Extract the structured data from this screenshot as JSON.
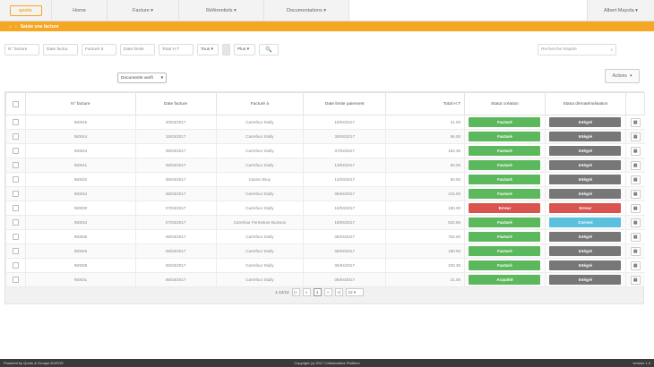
{
  "nav": {
    "logo": "qonto",
    "items": [
      "Home",
      "Facture ▾",
      "Référentiels ▾",
      "Documentations ▾"
    ],
    "user": "Albert Mayola ▾"
  },
  "breadcrumb": {
    "home": "⌂",
    "sep": "›",
    "current": "Saisie une facture"
  },
  "filters": {
    "invoice_no": "N° facture",
    "invoice_date": "Date factur.",
    "billed_to": "Facturé à",
    "due_date": "Date limite",
    "total": "Total H.T",
    "status_select": "Tous ▾",
    "plus_select": "Plus ▾",
    "search_icon": "🔍",
    "quick_search": "Recherche Rapide"
  },
  "doc_select": "Documents verifi",
  "actions_label": "Actions",
  "table": {
    "headers": [
      "",
      "N° facture",
      "Date facture",
      "Facturé à",
      "Date limite paiement",
      "Total H.T",
      "Statut création",
      "Statut dématérialisation",
      ""
    ],
    "rows": [
      {
        "no": "IN0045",
        "date": "20/03/2017",
        "to": "Carrefour Stully",
        "due": "19/04/2017",
        "total": "21.00",
        "creation": "Facturé",
        "cstat": "green",
        "demat": "Intégré",
        "dstat": "grey"
      },
      {
        "no": "IN0044",
        "date": "15/03/2017",
        "to": "Carrefour Stully",
        "due": "30/04/2017",
        "total": "96.00",
        "creation": "Facturé",
        "cstat": "green",
        "demat": "Intégré",
        "dstat": "grey"
      },
      {
        "no": "IN0043",
        "date": "08/03/2017",
        "to": "Carrefour Stully",
        "due": "07/04/2017",
        "total": "182.35",
        "creation": "Facturé",
        "cstat": "green",
        "demat": "Intégré",
        "dstat": "grey"
      },
      {
        "no": "IN0041",
        "date": "06/03/2017",
        "to": "Carrefour Stully",
        "due": "13/04/2017",
        "total": "90.00",
        "creation": "Facturé",
        "cstat": "green",
        "demat": "Intégré",
        "dstat": "grey"
      },
      {
        "no": "IN0032",
        "date": "06/03/2017",
        "to": "Casino Bruy",
        "due": "13/03/2017",
        "total": "90.00",
        "creation": "Facturé",
        "cstat": "green",
        "demat": "Intégré",
        "dstat": "grey"
      },
      {
        "no": "IN0034",
        "date": "06/03/2017",
        "to": "Carrefour Stully",
        "due": "06/04/2017",
        "total": "215.00",
        "creation": "Facturé",
        "cstat": "green",
        "demat": "Intégré",
        "dstat": "grey"
      },
      {
        "no": "IN0030",
        "date": "07/03/2017",
        "to": "Carrefour Stully",
        "due": "19/03/2017",
        "total": "180.00",
        "creation": "Erreur",
        "cstat": "red",
        "demat": "Erreur",
        "dstat": "red"
      },
      {
        "no": "IN0034",
        "date": "07/03/2017",
        "to": "Carrefour Fermeture Buisson",
        "due": "19/04/2017",
        "total": "520.55",
        "creation": "Facturé",
        "cstat": "green",
        "demat": "Correct",
        "dstat": "blue"
      },
      {
        "no": "IN0036",
        "date": "06/03/2017",
        "to": "Carrefour Stully",
        "due": "06/04/2017",
        "total": "762.00",
        "creation": "Facturé",
        "cstat": "green",
        "demat": "Intégré",
        "dstat": "grey"
      },
      {
        "no": "IN0046",
        "date": "06/03/2017",
        "to": "Carrefour Stully",
        "due": "06/04/2017",
        "total": "180.00",
        "creation": "Facturé",
        "cstat": "green",
        "demat": "Intégré",
        "dstat": "grey"
      },
      {
        "no": "IN0038",
        "date": "06/03/2017",
        "to": "Carrefour Stully",
        "due": "06/04/2017",
        "total": "220.35",
        "creation": "Facturé",
        "cstat": "green",
        "demat": "Intégré",
        "dstat": "grey"
      },
      {
        "no": "IN0031",
        "date": "06/03/2017",
        "to": "Carrefour Stully",
        "due": "06/04/2017",
        "total": "21.00",
        "creation": "Acquitté",
        "cstat": "green",
        "demat": "Intégré",
        "dstat": "grey"
      }
    ],
    "row_button": "▦"
  },
  "pager": {
    "info": "1-12/12",
    "first": "|«",
    "prev": "«",
    "page": "1",
    "next": "»",
    "last": "»|",
    "per_page": "12 ▾"
  },
  "footer": {
    "left": "Powered by Qonto & Groupe EUROS",
    "center": "Copyright (c) 2017 Collaborative Platform",
    "right": "version 1.0"
  },
  "colors": {
    "accent": "#f5a623",
    "green": "#5cb85c",
    "red": "#d9534f",
    "grey": "#777777",
    "blue": "#5bc0de"
  }
}
